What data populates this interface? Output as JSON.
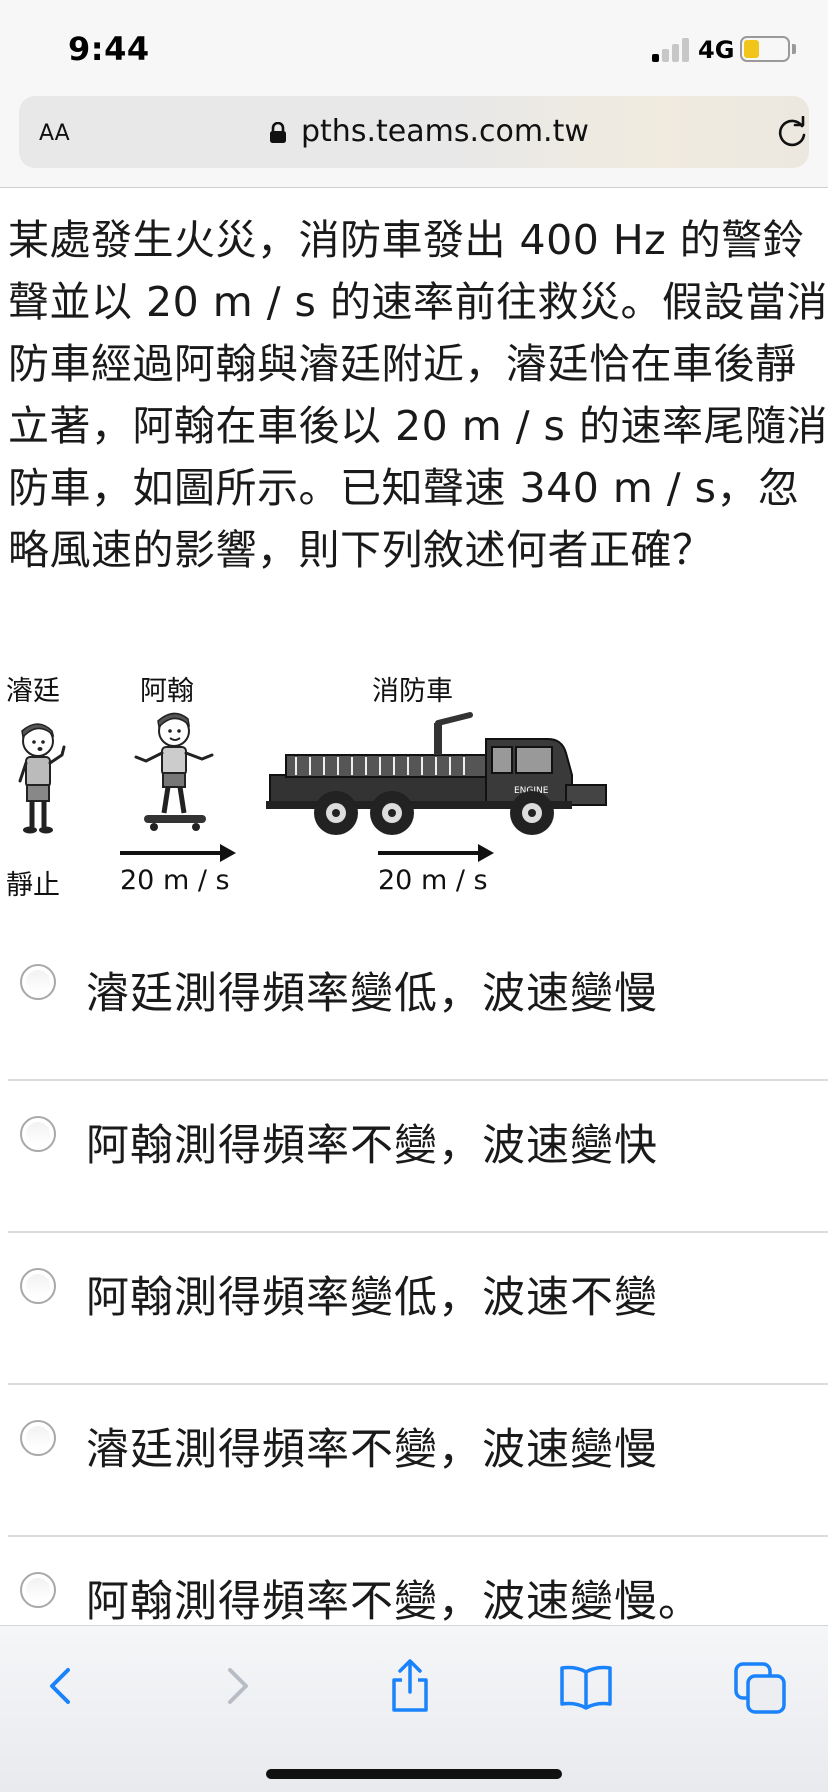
{
  "status_bar": {
    "time": "9:44",
    "network": "4G",
    "battery_level": 0.35,
    "battery_color": "#f2c51b"
  },
  "address_bar": {
    "text_size_button": "AA",
    "url": "pths.teams.com.tw"
  },
  "question": {
    "text": "某處發生火災，消防車發出 400 Hz 的警鈴聲並以 20 m / s 的速率前往救災。假設當消防車經過阿翰與濬廷附近，濬廷恰在車後靜立著，阿翰在車後以 20 m / s 的速率尾隨消防車，如圖所示。已知聲速 340 m / s，忽略風速的影響，則下列敘述何者正確？"
  },
  "figure": {
    "label_junting": "濬廷",
    "label_ahan": "阿翰",
    "label_firetruck": "消防車",
    "label_stationary": "靜止",
    "ahan_speed": "20 m / s",
    "truck_speed": "20 m / s",
    "truck_badge": "ENGINE"
  },
  "options": [
    {
      "label": "濬廷測得頻率變低，波速變慢"
    },
    {
      "label": "阿翰測得頻率不變，波速變快"
    },
    {
      "label": "阿翰測得頻率變低，波速不變"
    },
    {
      "label": "濬廷測得頻率不變，波速變慢"
    },
    {
      "label": "阿翰測得頻率不變，波速變慢。"
    }
  ],
  "toolbar": {
    "accent_color": "#1a82fb",
    "disabled_color": "#b8bcc4",
    "icons": [
      "back-icon",
      "forward-icon",
      "share-icon",
      "bookmarks-icon",
      "tabs-icon"
    ]
  }
}
